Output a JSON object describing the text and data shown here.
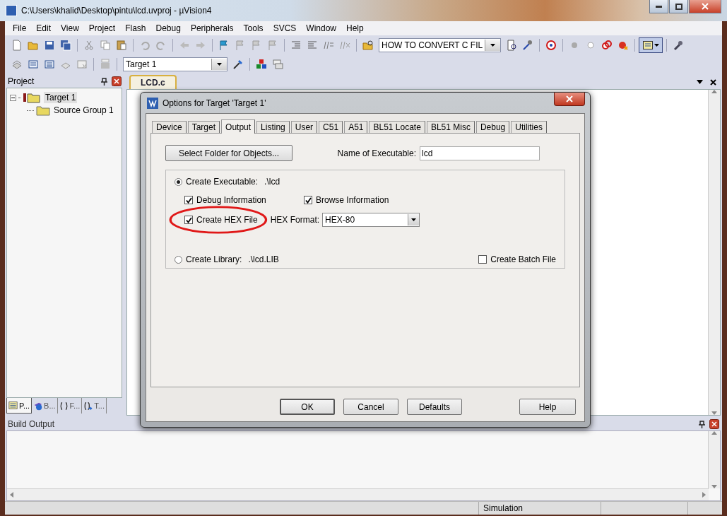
{
  "window": {
    "title": "C:\\Users\\khalid\\Desktop\\pintu\\lcd.uvproj - µVision4"
  },
  "menu": [
    "File",
    "Edit",
    "View",
    "Project",
    "Flash",
    "Debug",
    "Peripherals",
    "Tools",
    "SVCS",
    "Window",
    "Help"
  ],
  "toolbar": {
    "find_combo": "HOW TO CONVERT C FIL",
    "target_combo": "Target 1"
  },
  "project_panel": {
    "title": "Project",
    "tree": [
      {
        "label": "Target 1",
        "selected": true,
        "expanded": true,
        "children": [
          {
            "label": "Source Group 1",
            "selected": false
          }
        ]
      }
    ],
    "tabs": [
      {
        "label": "P...",
        "selected": true
      },
      {
        "label": "B...",
        "selected": false
      },
      {
        "label": "F...",
        "selected": false
      },
      {
        "label": "T...",
        "selected": false
      }
    ]
  },
  "editor": {
    "tabs": [
      {
        "label": "LCD.c",
        "selected": true
      }
    ]
  },
  "dialog": {
    "title": "Options for Target 'Target 1'",
    "tabs": [
      {
        "label": "Device",
        "selected": false
      },
      {
        "label": "Target",
        "selected": false
      },
      {
        "label": "Output",
        "selected": true
      },
      {
        "label": "Listing",
        "selected": false
      },
      {
        "label": "User",
        "selected": false
      },
      {
        "label": "C51",
        "selected": false
      },
      {
        "label": "A51",
        "selected": false
      },
      {
        "label": "BL51 Locate",
        "selected": false
      },
      {
        "label": "BL51 Misc",
        "selected": false
      },
      {
        "label": "Debug",
        "selected": false
      },
      {
        "label": "Utilities",
        "selected": false
      }
    ],
    "select_folder_button": "Select Folder for Objects...",
    "name_label": "Name of Executable:",
    "name_value": "lcd",
    "create_executable": {
      "label": "Create Executable:",
      "path": ".\\lcd",
      "selected": true
    },
    "debug_information": {
      "label": "Debug Information",
      "checked": true
    },
    "browse_information": {
      "label": "Browse Information",
      "checked": true
    },
    "create_hex": {
      "label": "Create HEX File",
      "checked": true
    },
    "hex_format_label": "HEX Format:",
    "hex_format_value": "HEX-80",
    "create_library": {
      "label": "Create Library:",
      "path": ".\\lcd.LIB",
      "selected": false
    },
    "create_batch": {
      "label": "Create Batch File",
      "checked": false
    },
    "buttons": [
      "OK",
      "Cancel",
      "Defaults",
      "Help"
    ]
  },
  "build_output": {
    "title": "Build Output"
  },
  "status_bar": {
    "mode": "Simulation"
  }
}
